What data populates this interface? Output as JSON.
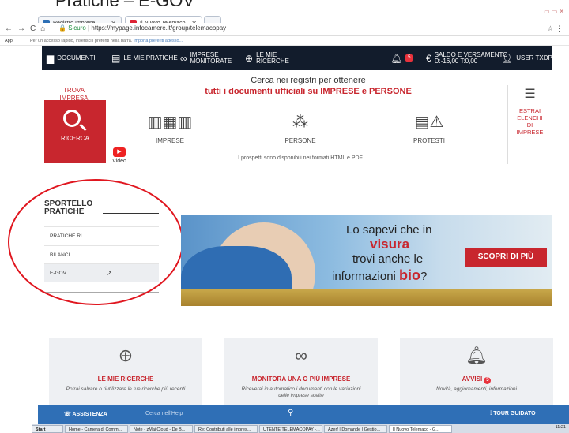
{
  "caption": "Pratiche – E-GOV",
  "browser": {
    "tabs": [
      {
        "label": "Registro Imprese"
      },
      {
        "label": "Il Nuovo Telemaco"
      }
    ],
    "url_secure": "Sicuro",
    "url": "https://mypage.infocamere.it/group/telemacopay",
    "bookmarks_apps": "App",
    "bookmarks_text": "Per un accesso rapido, inserisci i preferiti nella barra.",
    "bookmarks_link": "Importa preferiti adesso..."
  },
  "nav": {
    "documenti": "DOCUMENTI",
    "pratiche": "LE MIE PRATICHE",
    "imprese_1": "IMPRESE",
    "imprese_2": "MONITORATE",
    "ricerche_1": "LE MIE",
    "ricerche_2": "RICERCHE",
    "notif_count": "5",
    "saldo_1": "SALDO E VERSAMENTO",
    "saldo_2": "D:-16,00 T:0,00",
    "user": "USER TXDPFX"
  },
  "hero": {
    "trova_1": "TROVA",
    "trova_2": "IMPRESA",
    "ricerca": "RICERCA",
    "line1": "Cerca nei registri per ottenere",
    "line2": "tutti i documenti ufficiali su IMPRESE e PERSONE",
    "cats": [
      "IMPRESE",
      "PERSONE",
      "PROTESTI"
    ],
    "estrai": [
      "ESTRAI",
      "ELENCHI",
      "DI",
      "IMPRESE"
    ],
    "video": "Video",
    "formats": "I prospetti sono disponibili nei formati HTML e PDF"
  },
  "sportello": {
    "title_1": "SPORTELLO",
    "title_2": "PRATICHE",
    "items": [
      "PRATICHE RI",
      "BILANCI",
      "E-GOV"
    ]
  },
  "banner": {
    "l1": "Lo sapevi che in",
    "l2": "visura",
    "l3": "trovi anche le",
    "l4a": "informazioni",
    "l4b": "bio",
    "l4c": "?",
    "cta": "SCOPRI DI PIÙ"
  },
  "cards": [
    {
      "title": "LE MIE RICERCHE",
      "desc": "Potrai salvare o riutilizzare le tue ricerche più recenti"
    },
    {
      "title": "MONITORA UNA O PIÙ IMPRESE",
      "desc": "Riceverai in automatico i documenti con le variazioni delle imprese scelte"
    },
    {
      "title": "AVVISI",
      "badge": "5",
      "desc": "Novità, aggiornamenti, informazioni"
    }
  ],
  "help": {
    "assistenza": "ASSISTENZA",
    "search_placeholder": "Cerca nell'Help",
    "tour": "TOUR GUIDATO"
  },
  "taskbar": {
    "start": "Start",
    "items": [
      "Home - Camera di Comm...",
      "Note - zMailCloud - De B...",
      "Re: Contributi alle impres...",
      "UTENTE TELEMACOPAY -...",
      "Azerf | Domande | Gestio...",
      "Il Nuovo Telemaco - G..."
    ],
    "clock": "11:21"
  }
}
